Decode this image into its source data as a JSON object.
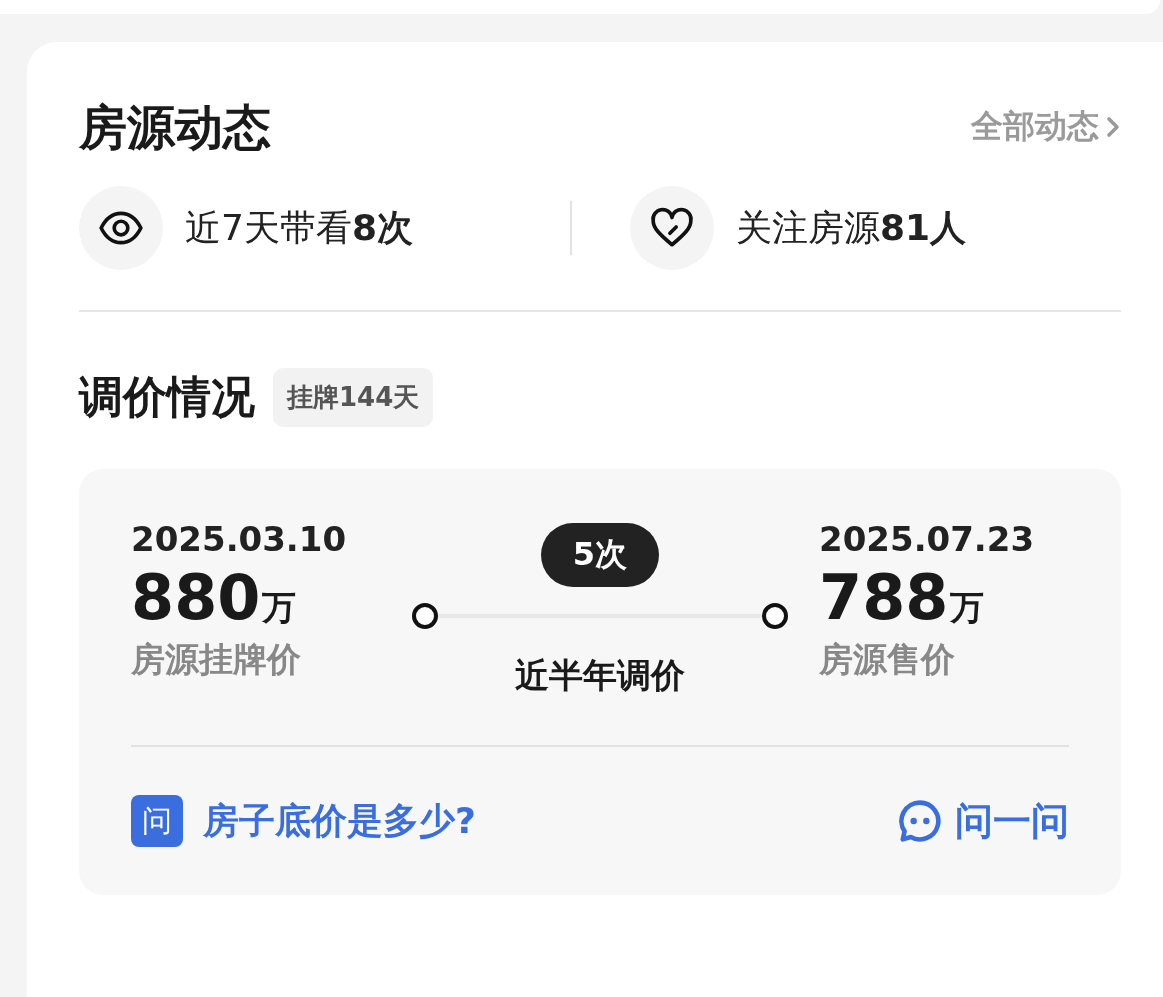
{
  "section_header": {
    "title": "房源动态",
    "link": "全部动态"
  },
  "stats": [
    {
      "kind": "views",
      "text": "近7天带看**8次**"
    },
    {
      "kind": "followers",
      "text": "关注房源**81人**"
    }
  ],
  "price_adjustment": {
    "title": "调价情况",
    "listing_tag": "挂牌144天",
    "start": {
      "date": "2025.03.10",
      "price": "880",
      "unit": "万",
      "label": "房源挂牌价"
    },
    "count": "5次",
    "period": "近半年调价",
    "end": {
      "date": "2025.07.23",
      "price": "788",
      "unit": "万",
      "label": "房源售价"
    }
  },
  "ask": {
    "badge": "问",
    "question": "房子底价是多少?",
    "button": "问一问"
  }
}
